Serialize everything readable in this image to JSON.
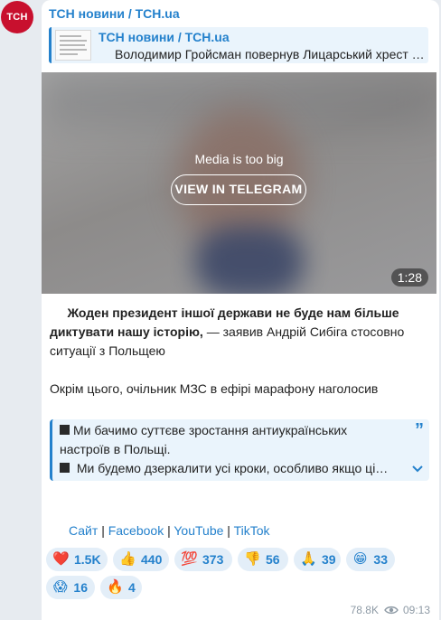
{
  "avatar": {
    "initials": "ТСН"
  },
  "post": {
    "author": "ТСН новини / TCH.ua",
    "reply": {
      "author": "ТСН новини / TCH.ua",
      "text": "Володимир Гройсман повернув Лицарський хрест …"
    },
    "media": {
      "message": "Media is too big",
      "button_label": "VIEW IN TELEGRAM",
      "duration": "1:28"
    },
    "text": {
      "bold_quote": "Жоден президент іншої держави не буде нам більше диктувати нашу історію,",
      "rest": " — заявив Андрій Сибіга стосовно ситуації з Польщею",
      "paragraph2": "Окрім цього, очільник МЗС в ефірі марафону наголосив"
    },
    "quote": {
      "line1": "Ми бачимо суттєве зростання антиукраїнських настроїв в Польщі.",
      "line2": "Ми будемо дзеркалити усі кроки, особливо якщо ці…"
    },
    "links": {
      "site": "Сайт",
      "facebook": "Facebook",
      "youtube": "YouTube",
      "tiktok": "TikTok",
      "separator": "|"
    },
    "reactions": [
      {
        "icon": "red-heart-icon",
        "emoji": "❤️",
        "count": "1.5K"
      },
      {
        "icon": "thumbs-up-icon",
        "emoji": "👍",
        "count": "440"
      },
      {
        "icon": "hundred-points-icon",
        "emoji": "💯",
        "count": "373"
      },
      {
        "icon": "thumbs-down-icon",
        "emoji": "👎",
        "count": "56"
      },
      {
        "icon": "folded-hands-icon",
        "emoji": "🙏",
        "count": "39"
      },
      {
        "icon": "grinning-face-icon",
        "emoji": "😁",
        "count": "33"
      },
      {
        "icon": "screaming-face-icon",
        "emoji": "😱",
        "count": "16"
      },
      {
        "icon": "fire-icon",
        "emoji": "🔥",
        "count": "4"
      }
    ],
    "footer": {
      "views": "78.8K",
      "time": "09:13"
    }
  },
  "colors": {
    "accent": "#2481cc",
    "avatar_bg": "#c8102e",
    "background": "#e7ebf0"
  }
}
